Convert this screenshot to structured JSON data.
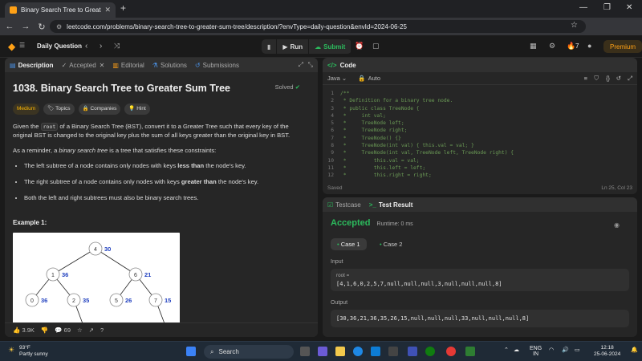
{
  "browser": {
    "tab_title": "Binary Search Tree to Greater Su",
    "url": "leetcode.com/problems/binary-search-tree-to-greater-sum-tree/description/?envType=daily-question&envId=2024-06-25"
  },
  "header": {
    "daily_question": "Daily Question",
    "run": "Run",
    "submit": "Submit",
    "streak": "7",
    "premium": "Premium"
  },
  "left_tabs": [
    "Description",
    "Accepted",
    "Editorial",
    "Solutions",
    "Submissions"
  ],
  "problem": {
    "title": "1038. Binary Search Tree to Greater Sum Tree",
    "status": "Solved",
    "difficulty": "Medium",
    "topics": "Topics",
    "companies": "Companies",
    "hint": "Hint",
    "para1_pre": "Given the ",
    "para1_code": "root",
    "para1_post": " of a Binary Search Tree (BST), convert it to a Greater Tree such that every key of the original BST is changed to the original key plus the sum of all keys greater than the original key in BST.",
    "para2_pre": "As a reminder, a ",
    "para2_em": "binary search tree",
    "para2_post": " is a tree that satisfies these constraints:",
    "bullets": [
      {
        "pre": "The left subtree of a node contains only nodes with keys ",
        "b": "less than",
        "post": " the node's key."
      },
      {
        "pre": "The right subtree of a node contains only nodes with keys ",
        "b": "greater than",
        "post": " the node's key."
      },
      {
        "pre": "Both the left and right subtrees must also be binary search trees.",
        "b": "",
        "post": ""
      }
    ],
    "example_title": "Example 1:",
    "tree_nodes": [
      {
        "v": "4",
        "s": "30"
      },
      {
        "v": "1",
        "s": "36"
      },
      {
        "v": "6",
        "s": "21"
      },
      {
        "v": "0",
        "s": "36"
      },
      {
        "v": "2",
        "s": "35"
      },
      {
        "v": "5",
        "s": "26"
      },
      {
        "v": "7",
        "s": "15"
      }
    ],
    "likes": "3.9K",
    "comments": "69"
  },
  "code_panel": {
    "title": "Code",
    "language": "Java",
    "mode": "Auto",
    "status": "Saved",
    "cursor": "Ln 25, Col 23",
    "lines": [
      {
        "n": "1",
        "t": "/**"
      },
      {
        "n": "2",
        "t": " * Definition for a binary tree node."
      },
      {
        "n": "3",
        "t": " * public class TreeNode {"
      },
      {
        "n": "4",
        "t": " *     int val;"
      },
      {
        "n": "5",
        "t": " *     TreeNode left;"
      },
      {
        "n": "6",
        "t": " *     TreeNode right;"
      },
      {
        "n": "7",
        "t": " *     TreeNode() {}"
      },
      {
        "n": "8",
        "t": " *     TreeNode(int val) { this.val = val; }"
      },
      {
        "n": "9",
        "t": " *     TreeNode(int val, TreeNode left, TreeNode right) {"
      },
      {
        "n": "10",
        "t": " *         this.val = val;"
      },
      {
        "n": "11",
        "t": " *         this.left = left;"
      },
      {
        "n": "12",
        "t": " *         this.right = right;"
      }
    ]
  },
  "result_panel": {
    "tab_testcase": "Testcase",
    "tab_result": "Test Result",
    "verdict": "Accepted",
    "runtime": "Runtime: 0 ms",
    "case1": "Case 1",
    "case2": "Case 2",
    "input_label": "Input",
    "input_name": "root =",
    "input_value": "[4,1,6,0,2,5,7,null,null,null,3,null,null,null,8]",
    "output_label": "Output",
    "output_value": "[30,36,21,36,35,26,15,null,null,null,33,null,null,null,8]"
  },
  "taskbar": {
    "temp": "93°F",
    "weather": "Partly sunny",
    "search": "Search",
    "lang1": "ENG",
    "lang2": "IN",
    "time": "12:18",
    "date": "25-06-2024"
  }
}
